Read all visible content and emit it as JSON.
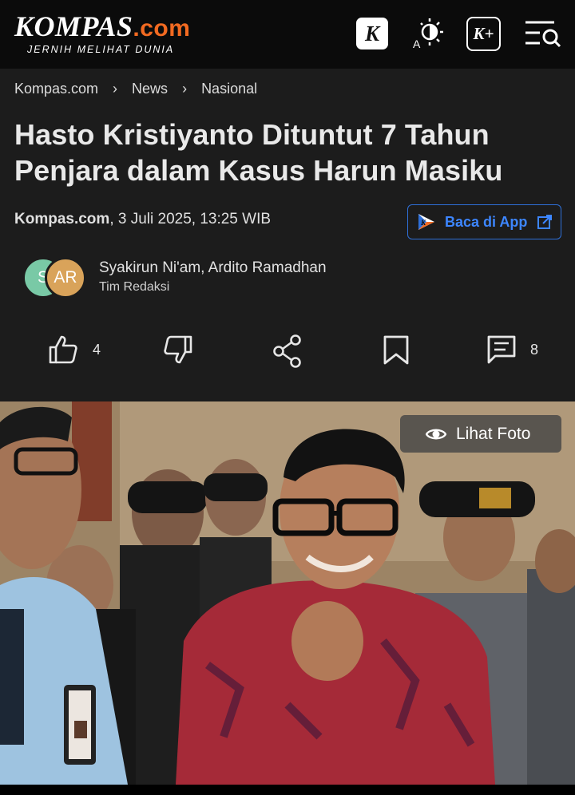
{
  "header": {
    "logo_main": "KOMPAS",
    "logo_domain": ".com",
    "logo_tagline": "JERNIH MELIHAT DUNIA",
    "k_icon_label": "K",
    "contrast_icon_label": "A",
    "kplus_label": "K+",
    "accent_color": "#f26a21"
  },
  "breadcrumb": [
    "Kompas.com",
    "News",
    "Nasional"
  ],
  "article": {
    "title": "Hasto Kristiyanto Dituntut 7 Tahun Penjara dalam Kasus Harun Masiku",
    "source": "Kompas.com",
    "date": ", 3 Juli 2025, 13:25 WIB",
    "app_button": "Baca di App",
    "authors": "Syakirun Ni'am,  Ardito Ramadhan",
    "team": "Tim Redaksi",
    "avatar_1": "S",
    "avatar_2": "AR"
  },
  "actions": {
    "like_count": "4",
    "comment_count": "8"
  },
  "photo": {
    "view_label": "Lihat Foto"
  }
}
